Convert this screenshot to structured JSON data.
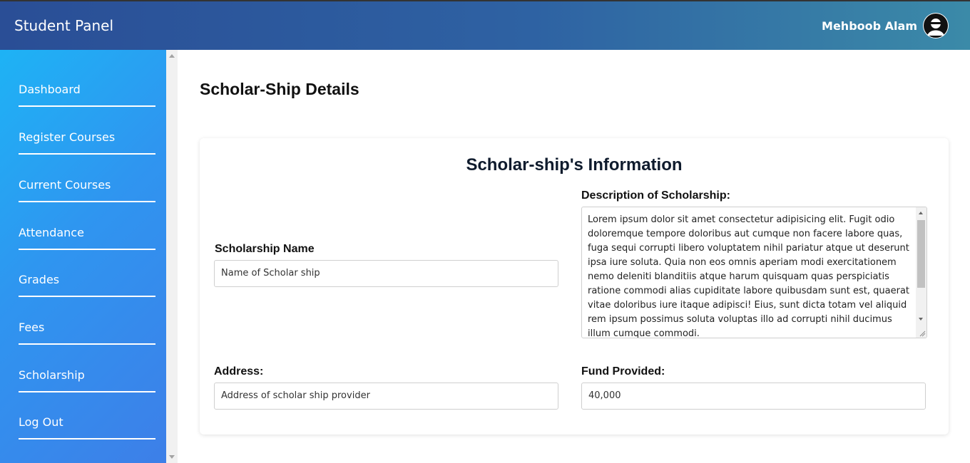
{
  "header": {
    "brand": "Student Panel",
    "user_name": "Mehboob Alam",
    "avatar_icon": "avatar-icon",
    "gradient": [
      "#2a4e96",
      "#3b8aa8"
    ]
  },
  "sidebar": {
    "gradient": [
      "#1eb3f5",
      "#3d7fe8"
    ],
    "items": [
      {
        "label": "Dashboard"
      },
      {
        "label": "Register Courses"
      },
      {
        "label": "Current Courses"
      },
      {
        "label": "Attendance"
      },
      {
        "label": "Grades"
      },
      {
        "label": "Fees"
      },
      {
        "label": "Scholarship"
      },
      {
        "label": "Log Out"
      }
    ]
  },
  "main": {
    "page_title": "Scholar-Ship Details",
    "card_title": "Scholar-ship's Information",
    "fields": {
      "scholarship_name_label": "Scholarship Name",
      "scholarship_name_value": "Name of Scholar ship",
      "description_label": "Description of Scholarship:",
      "description_value": "Lorem ipsum dolor sit amet consectetur adipisicing elit. Fugit odio doloremque tempore doloribus aut cumque non facere labore quas, fuga sequi corrupti libero voluptatem nihil pariatur atque ut deserunt ipsa iure soluta. Quia non eos omnis aperiam modi exercitationem nemo deleniti blanditiis atque harum quisquam quas perspiciatis ratione commodi alias cupiditate labore quibusdam sunt est, quaerat vitae doloribus iure itaque adipisci! Eius, sunt dicta totam vel aliquid rem ipsum possimus soluta voluptas illo ad corrupti nihil ducimus illum cumque commodi.",
      "address_label": "Address:",
      "address_value": "Address of scholar ship provider",
      "fund_label": "Fund Provided:",
      "fund_value": "40,000"
    }
  }
}
